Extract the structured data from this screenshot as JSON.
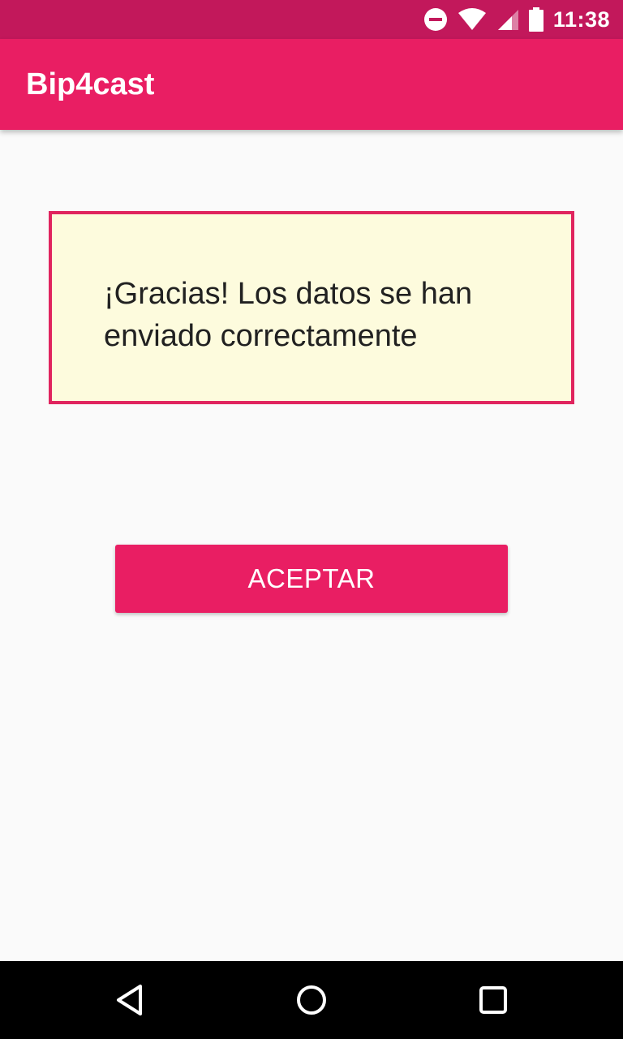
{
  "status_bar": {
    "time": "11:38",
    "icons": [
      "do-not-disturb-icon",
      "wifi-icon",
      "signal-icon",
      "battery-icon"
    ],
    "background": "#c2185b"
  },
  "app_bar": {
    "title": "Bip4cast",
    "background": "#e91e63"
  },
  "message": {
    "text": "¡Gracias! Los datos se han enviado correctamente",
    "background": "#fdfbdd",
    "border_color": "#e0245e"
  },
  "accept_button": {
    "label": "ACEPTAR",
    "background": "#e91e63"
  },
  "nav_bar": {
    "buttons": [
      "back-icon",
      "home-icon",
      "recents-icon"
    ]
  }
}
